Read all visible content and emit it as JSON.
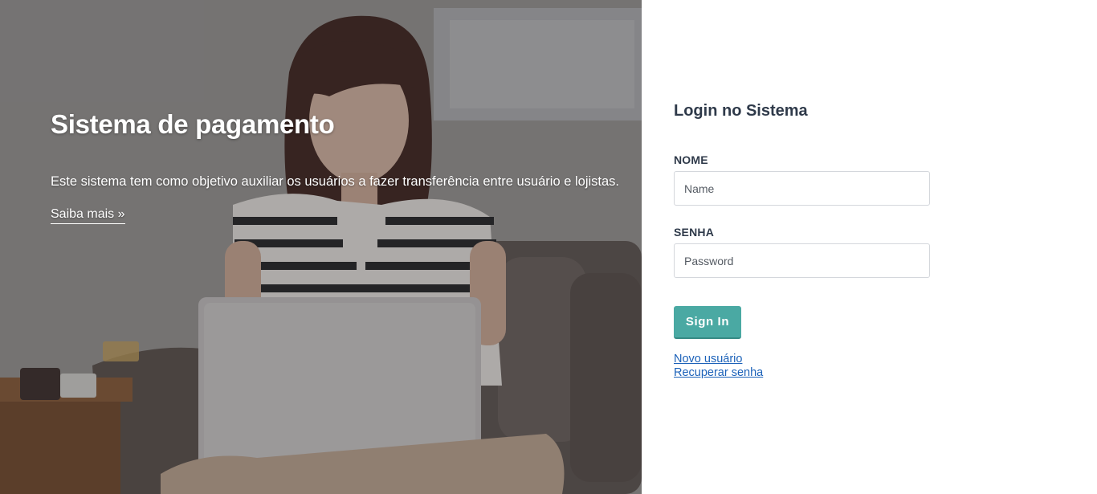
{
  "hero": {
    "title": "Sistema de pagamento",
    "description": "Este sistema tem como objetivo auxiliar os usuários a fazer transferência entre usuário e lojistas.",
    "link_label": "Saiba mais »"
  },
  "login": {
    "title": "Login no Sistema",
    "name_label": "NOME",
    "name_placeholder": "Name",
    "name_value": "",
    "password_label": "SENHA",
    "password_placeholder": "Password",
    "password_value": "",
    "signin_label": "Sign In",
    "new_user_link": "Novo usuário",
    "recover_link": "Recuperar senha"
  },
  "colors": {
    "accent": "#4aa9a3",
    "link": "#1c62b9",
    "heading": "#2f3a4a"
  }
}
